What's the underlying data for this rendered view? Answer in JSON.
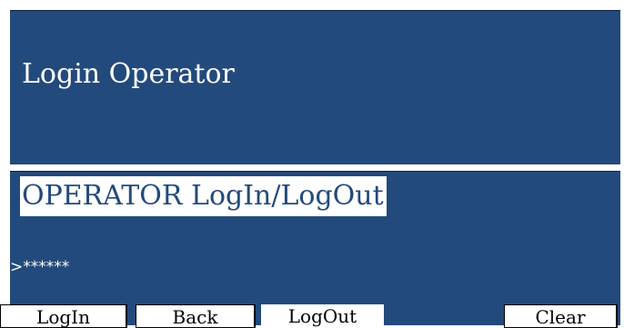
{
  "header": {
    "title": "Login Operator"
  },
  "main": {
    "subtitle": "OPERATOR LogIn/LogOut",
    "prompt": ">",
    "password_mask": "******"
  },
  "buttons": {
    "login": "LogIn",
    "back": "Back",
    "logout": "LogOut",
    "clear": "Clear"
  },
  "colors": {
    "panel_background": "#234a7c",
    "panel_text": "#ffffff",
    "button_background": "#ffffff",
    "button_text": "#000000"
  }
}
